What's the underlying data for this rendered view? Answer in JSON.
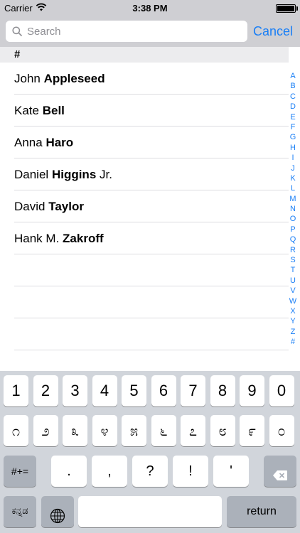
{
  "status_bar": {
    "carrier": "Carrier",
    "time": "3:38 PM"
  },
  "search": {
    "placeholder": "Search",
    "cancel_label": "Cancel"
  },
  "section": {
    "header": "#"
  },
  "contacts": [
    {
      "first": "John",
      "last": "Appleseed"
    },
    {
      "first": "Kate",
      "last": "Bell"
    },
    {
      "first": "Anna",
      "last": "Haro"
    },
    {
      "first": "Daniel",
      "last": "Higgins",
      "suffix": "Jr."
    },
    {
      "first": "Hank M.",
      "last": "Zakroff"
    }
  ],
  "contacts_full": [
    {
      "first": "John",
      "last": "Appleseed",
      "suffix": ""
    },
    {
      "first": "Kate",
      "last": "Bell",
      "suffix": ""
    },
    {
      "first": "Anna",
      "last": "Haro",
      "suffix": ""
    },
    {
      "first": "Daniel",
      "last": "Higgins",
      "suffix": " Jr."
    },
    {
      "first": "David",
      "last": "Taylor",
      "suffix": ""
    },
    {
      "first": "Hank M.",
      "last": "Zakroff",
      "suffix": ""
    }
  ],
  "index_letters": [
    "A",
    "B",
    "C",
    "D",
    "E",
    "F",
    "G",
    "H",
    "I",
    "J",
    "K",
    "L",
    "M",
    "N",
    "O",
    "P",
    "Q",
    "R",
    "S",
    "T",
    "U",
    "V",
    "W",
    "X",
    "Y",
    "Z",
    "#"
  ],
  "keyboard": {
    "numbers": [
      "1",
      "2",
      "3",
      "4",
      "5",
      "6",
      "7",
      "8",
      "9",
      "0"
    ],
    "kannada_row": [
      "೧",
      "೨",
      "೩",
      "೪",
      "೫",
      "೬",
      "೭",
      "೮",
      "೯",
      "೦"
    ],
    "punctuation": [
      ".",
      ",",
      "?",
      "!",
      "'"
    ],
    "symbols_label": "#+=",
    "language_label": "ಕನ್ನಡ",
    "return_label": "return",
    "icons": {
      "backspace": "backspace-icon",
      "globe": "globe-icon"
    }
  },
  "colors": {
    "accent": "#1a7ff6",
    "bar_background": "#cfcfd3",
    "keyboard_background": "#d1d5db",
    "modifier_key": "#abb1ba"
  }
}
